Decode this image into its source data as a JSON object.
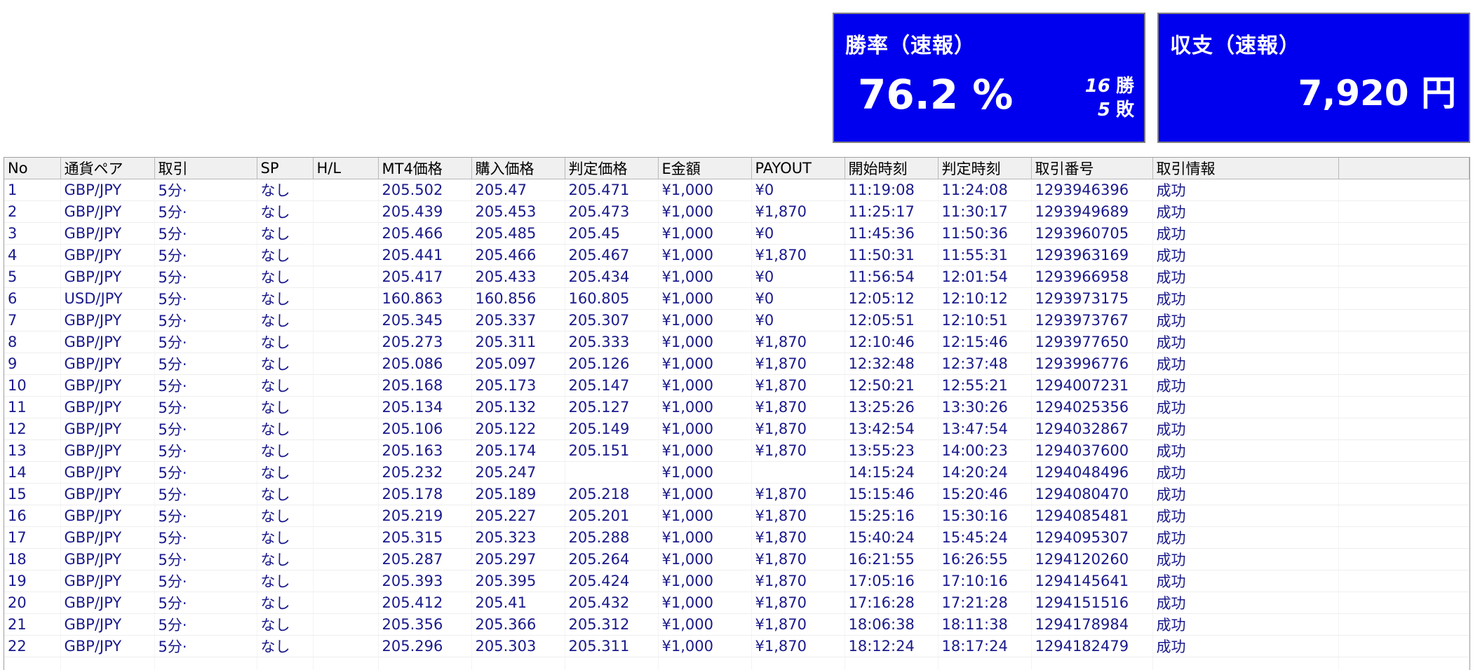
{
  "summary": {
    "winrate": {
      "title": "勝率（速報）",
      "value": "76.2 %",
      "wins": "16",
      "wins_label": "勝",
      "losses": "5",
      "losses_label": "敗"
    },
    "profit": {
      "title": "収支（速報）",
      "value": "7,920 円"
    }
  },
  "colors": {
    "panel_bg": "#0000ee",
    "panel_text": "#ffffff",
    "row_text": "#1a1a8c",
    "header_bg": "#f0f0f0"
  },
  "table": {
    "columns": [
      "No",
      "通貨ペア",
      "取引",
      "SP",
      "H/L",
      "MT4価格",
      "購入価格",
      "判定価格",
      "E金額",
      "PAYOUT",
      "開始時刻",
      "判定時刻",
      "取引番号",
      "取引情報",
      ""
    ],
    "rows": [
      [
        "1",
        "GBP/JPY",
        "5分·",
        "なし",
        "",
        "205.502",
        "205.47",
        "205.471",
        "¥1,000",
        "¥0",
        "11:19:08",
        "11:24:08",
        "1293946396",
        "成功",
        ""
      ],
      [
        "2",
        "GBP/JPY",
        "5分·",
        "なし",
        "",
        "205.439",
        "205.453",
        "205.473",
        "¥1,000",
        "¥1,870",
        "11:25:17",
        "11:30:17",
        "1293949689",
        "成功",
        ""
      ],
      [
        "3",
        "GBP/JPY",
        "5分·",
        "なし",
        "",
        "205.466",
        "205.485",
        "205.45",
        "¥1,000",
        "¥0",
        "11:45:36",
        "11:50:36",
        "1293960705",
        "成功",
        ""
      ],
      [
        "4",
        "GBP/JPY",
        "5分·",
        "なし",
        "",
        "205.441",
        "205.466",
        "205.467",
        "¥1,000",
        "¥1,870",
        "11:50:31",
        "11:55:31",
        "1293963169",
        "成功",
        ""
      ],
      [
        "5",
        "GBP/JPY",
        "5分·",
        "なし",
        "",
        "205.417",
        "205.433",
        "205.434",
        "¥1,000",
        "¥0",
        "11:56:54",
        "12:01:54",
        "1293966958",
        "成功",
        ""
      ],
      [
        "6",
        "USD/JPY",
        "5分·",
        "なし",
        "",
        "160.863",
        "160.856",
        "160.805",
        "¥1,000",
        "¥0",
        "12:05:12",
        "12:10:12",
        "1293973175",
        "成功",
        ""
      ],
      [
        "7",
        "GBP/JPY",
        "5分·",
        "なし",
        "",
        "205.345",
        "205.337",
        "205.307",
        "¥1,000",
        "¥0",
        "12:05:51",
        "12:10:51",
        "1293973767",
        "成功",
        ""
      ],
      [
        "8",
        "GBP/JPY",
        "5分·",
        "なし",
        "",
        "205.273",
        "205.311",
        "205.333",
        "¥1,000",
        "¥1,870",
        "12:10:46",
        "12:15:46",
        "1293977650",
        "成功",
        ""
      ],
      [
        "9",
        "GBP/JPY",
        "5分·",
        "なし",
        "",
        "205.086",
        "205.097",
        "205.126",
        "¥1,000",
        "¥1,870",
        "12:32:48",
        "12:37:48",
        "1293996776",
        "成功",
        ""
      ],
      [
        "10",
        "GBP/JPY",
        "5分·",
        "なし",
        "",
        "205.168",
        "205.173",
        "205.147",
        "¥1,000",
        "¥1,870",
        "12:50:21",
        "12:55:21",
        "1294007231",
        "成功",
        ""
      ],
      [
        "11",
        "GBP/JPY",
        "5分·",
        "なし",
        "",
        "205.134",
        "205.132",
        "205.127",
        "¥1,000",
        "¥1,870",
        "13:25:26",
        "13:30:26",
        "1294025356",
        "成功",
        ""
      ],
      [
        "12",
        "GBP/JPY",
        "5分·",
        "なし",
        "",
        "205.106",
        "205.122",
        "205.149",
        "¥1,000",
        "¥1,870",
        "13:42:54",
        "13:47:54",
        "1294032867",
        "成功",
        ""
      ],
      [
        "13",
        "GBP/JPY",
        "5分·",
        "なし",
        "",
        "205.163",
        "205.174",
        "205.151",
        "¥1,000",
        "¥1,870",
        "13:55:23",
        "14:00:23",
        "1294037600",
        "成功",
        ""
      ],
      [
        "14",
        "GBP/JPY",
        "5分·",
        "なし",
        "",
        "205.232",
        "205.247",
        "",
        "¥1,000",
        "",
        "14:15:24",
        "14:20:24",
        "1294048496",
        "成功",
        ""
      ],
      [
        "15",
        "GBP/JPY",
        "5分·",
        "なし",
        "",
        "205.178",
        "205.189",
        "205.218",
        "¥1,000",
        "¥1,870",
        "15:15:46",
        "15:20:46",
        "1294080470",
        "成功",
        ""
      ],
      [
        "16",
        "GBP/JPY",
        "5分·",
        "なし",
        "",
        "205.219",
        "205.227",
        "205.201",
        "¥1,000",
        "¥1,870",
        "15:25:16",
        "15:30:16",
        "1294085481",
        "成功",
        ""
      ],
      [
        "17",
        "GBP/JPY",
        "5分·",
        "なし",
        "",
        "205.315",
        "205.323",
        "205.288",
        "¥1,000",
        "¥1,870",
        "15:40:24",
        "15:45:24",
        "1294095307",
        "成功",
        ""
      ],
      [
        "18",
        "GBP/JPY",
        "5分·",
        "なし",
        "",
        "205.287",
        "205.297",
        "205.264",
        "¥1,000",
        "¥1,870",
        "16:21:55",
        "16:26:55",
        "1294120260",
        "成功",
        ""
      ],
      [
        "19",
        "GBP/JPY",
        "5分·",
        "なし",
        "",
        "205.393",
        "205.395",
        "205.424",
        "¥1,000",
        "¥1,870",
        "17:05:16",
        "17:10:16",
        "1294145641",
        "成功",
        ""
      ],
      [
        "20",
        "GBP/JPY",
        "5分·",
        "なし",
        "",
        "205.412",
        "205.41",
        "205.432",
        "¥1,000",
        "¥1,870",
        "17:16:28",
        "17:21:28",
        "1294151516",
        "成功",
        ""
      ],
      [
        "21",
        "GBP/JPY",
        "5分·",
        "なし",
        "",
        "205.356",
        "205.366",
        "205.312",
        "¥1,000",
        "¥1,870",
        "18:06:38",
        "18:11:38",
        "1294178984",
        "成功",
        ""
      ],
      [
        "22",
        "GBP/JPY",
        "5分·",
        "なし",
        "",
        "205.296",
        "205.303",
        "205.311",
        "¥1,000",
        "¥1,870",
        "18:12:24",
        "18:17:24",
        "1294182479",
        "成功",
        ""
      ]
    ]
  }
}
